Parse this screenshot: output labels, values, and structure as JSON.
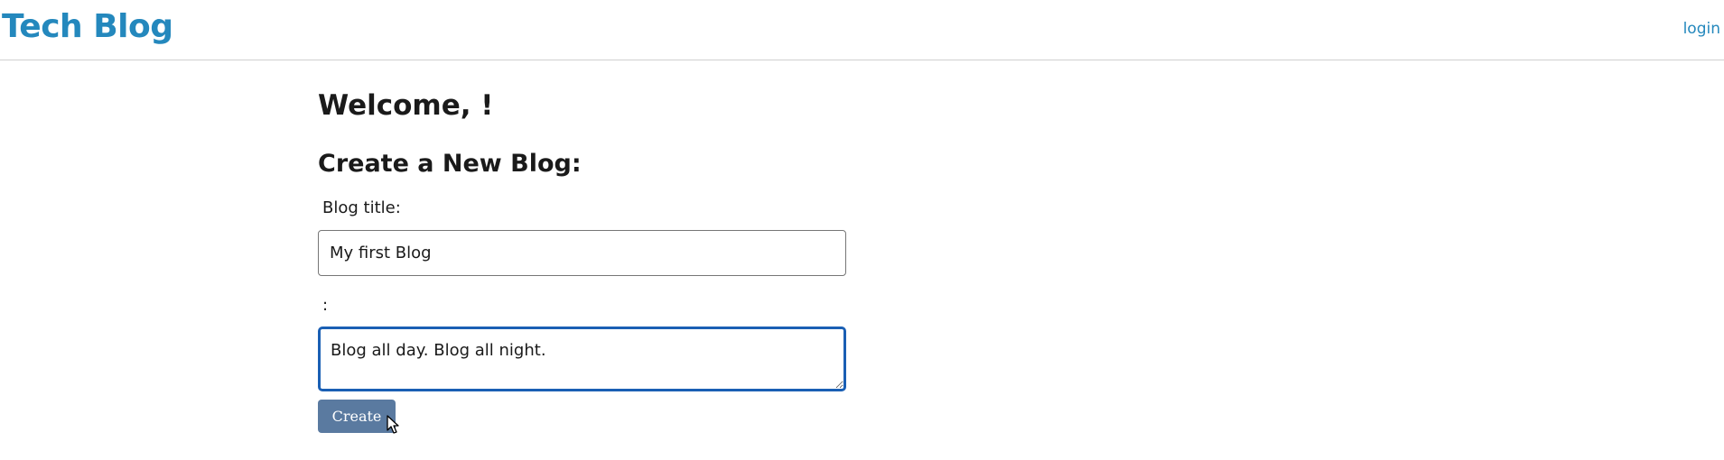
{
  "header": {
    "site_title": "Tech Blog",
    "login_label": "login"
  },
  "main": {
    "welcome": "Welcome, !",
    "create_heading": "Create a New Blog:",
    "title_label": "Blog title:",
    "title_value": "My first Blog",
    "body_label": ":",
    "body_value": "Blog all day. Blog all night.",
    "create_label": "Create"
  },
  "colors": {
    "brand": "#2488bd",
    "button": "#5a7aa0",
    "focus_border": "#1a5fb4"
  },
  "icons": {
    "cursor": "mouse-pointer-icon"
  }
}
